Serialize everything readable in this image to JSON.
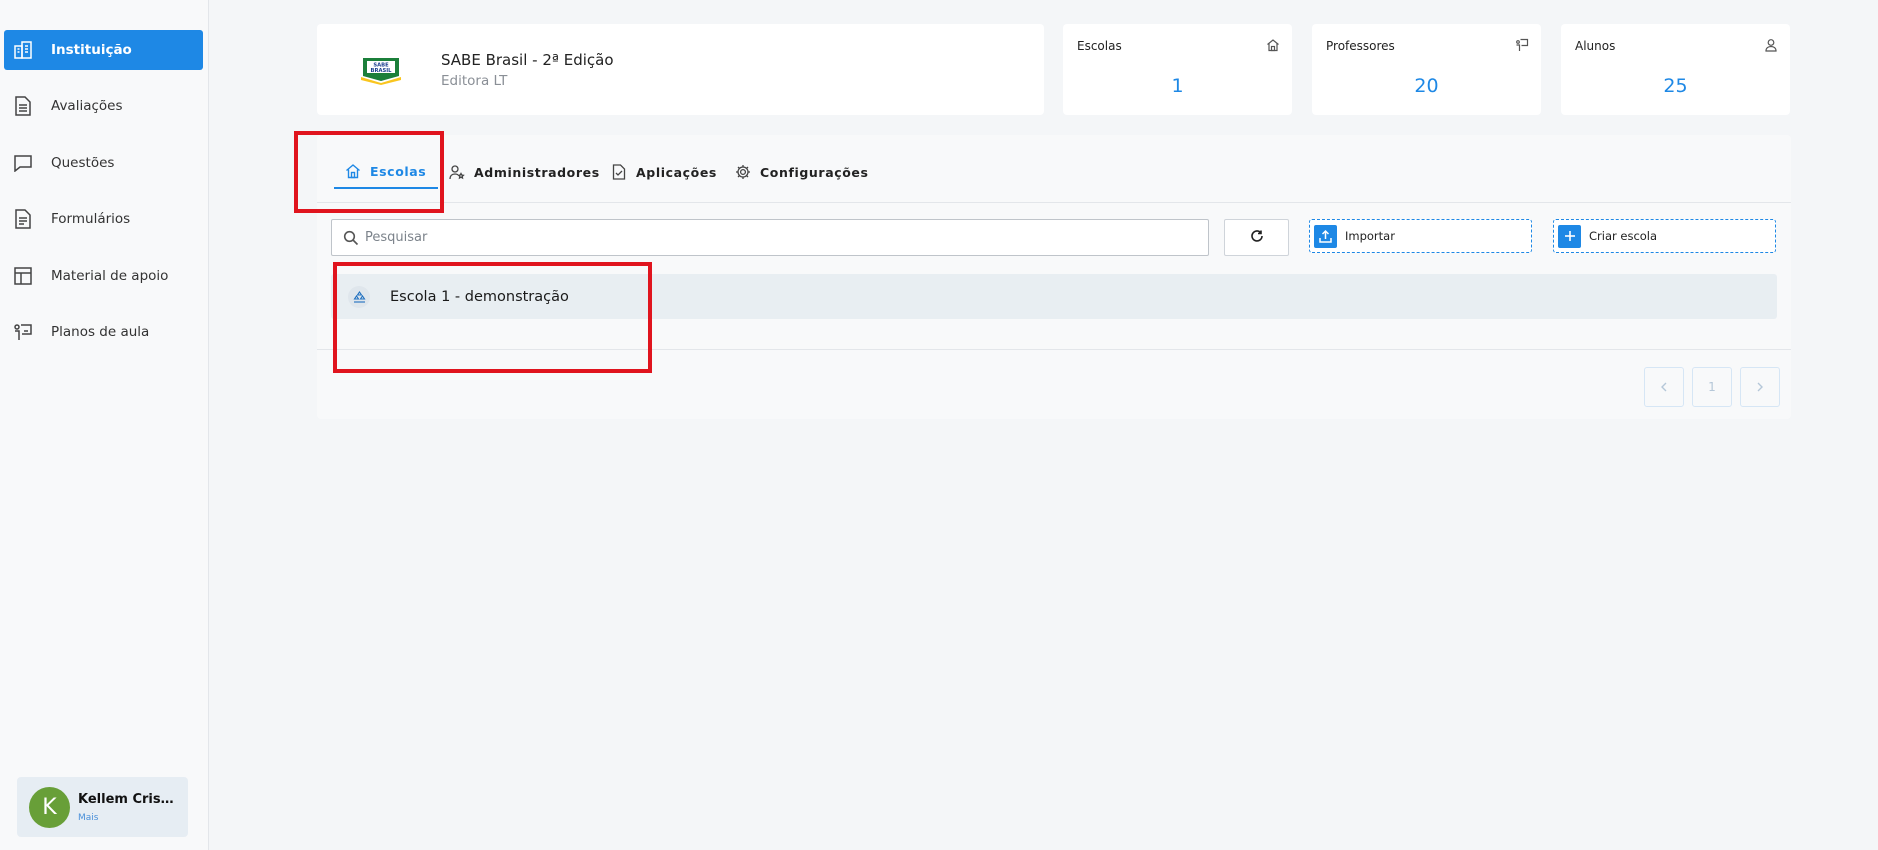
{
  "sidebar": {
    "items": [
      {
        "label": "Instituição",
        "icon": "building-icon",
        "active": true
      },
      {
        "label": "Avaliações",
        "icon": "document-icon"
      },
      {
        "label": "Questões",
        "icon": "chat-icon"
      },
      {
        "label": "Formulários",
        "icon": "form-icon"
      },
      {
        "label": "Material de apoio",
        "icon": "layout-icon"
      },
      {
        "label": "Planos de aula",
        "icon": "presentation-icon"
      }
    ],
    "user": {
      "initial": "K",
      "name": "Kellem Cristi...",
      "more": "Mais",
      "avatar_color": "#689f38"
    }
  },
  "institution": {
    "title": "SABE Brasil - 2ª Edição",
    "subtitle": "Editora LT",
    "logo_text": "SABE BRASIL"
  },
  "stats": [
    {
      "label": "Escolas",
      "value": "1",
      "icon": "home-icon"
    },
    {
      "label": "Professores",
      "value": "20",
      "icon": "teacher-icon"
    },
    {
      "label": "Alunos",
      "value": "25",
      "icon": "user-icon"
    }
  ],
  "tabs": [
    {
      "label": "Escolas",
      "icon": "home-icon",
      "active": true
    },
    {
      "label": "Administradores",
      "icon": "admin-icon"
    },
    {
      "label": "Aplicações",
      "icon": "file-check-icon"
    },
    {
      "label": "Configurações",
      "icon": "gear-icon"
    }
  ],
  "search": {
    "placeholder": "Pesquisar",
    "value": ""
  },
  "actions": {
    "import_label": "Importar",
    "create_label": "Criar escola"
  },
  "schools": [
    {
      "name": "Escola 1 - demonstração"
    }
  ],
  "pagination": {
    "current": "1"
  },
  "colors": {
    "accent": "#1e88e5",
    "highlight": "#e0141e"
  }
}
